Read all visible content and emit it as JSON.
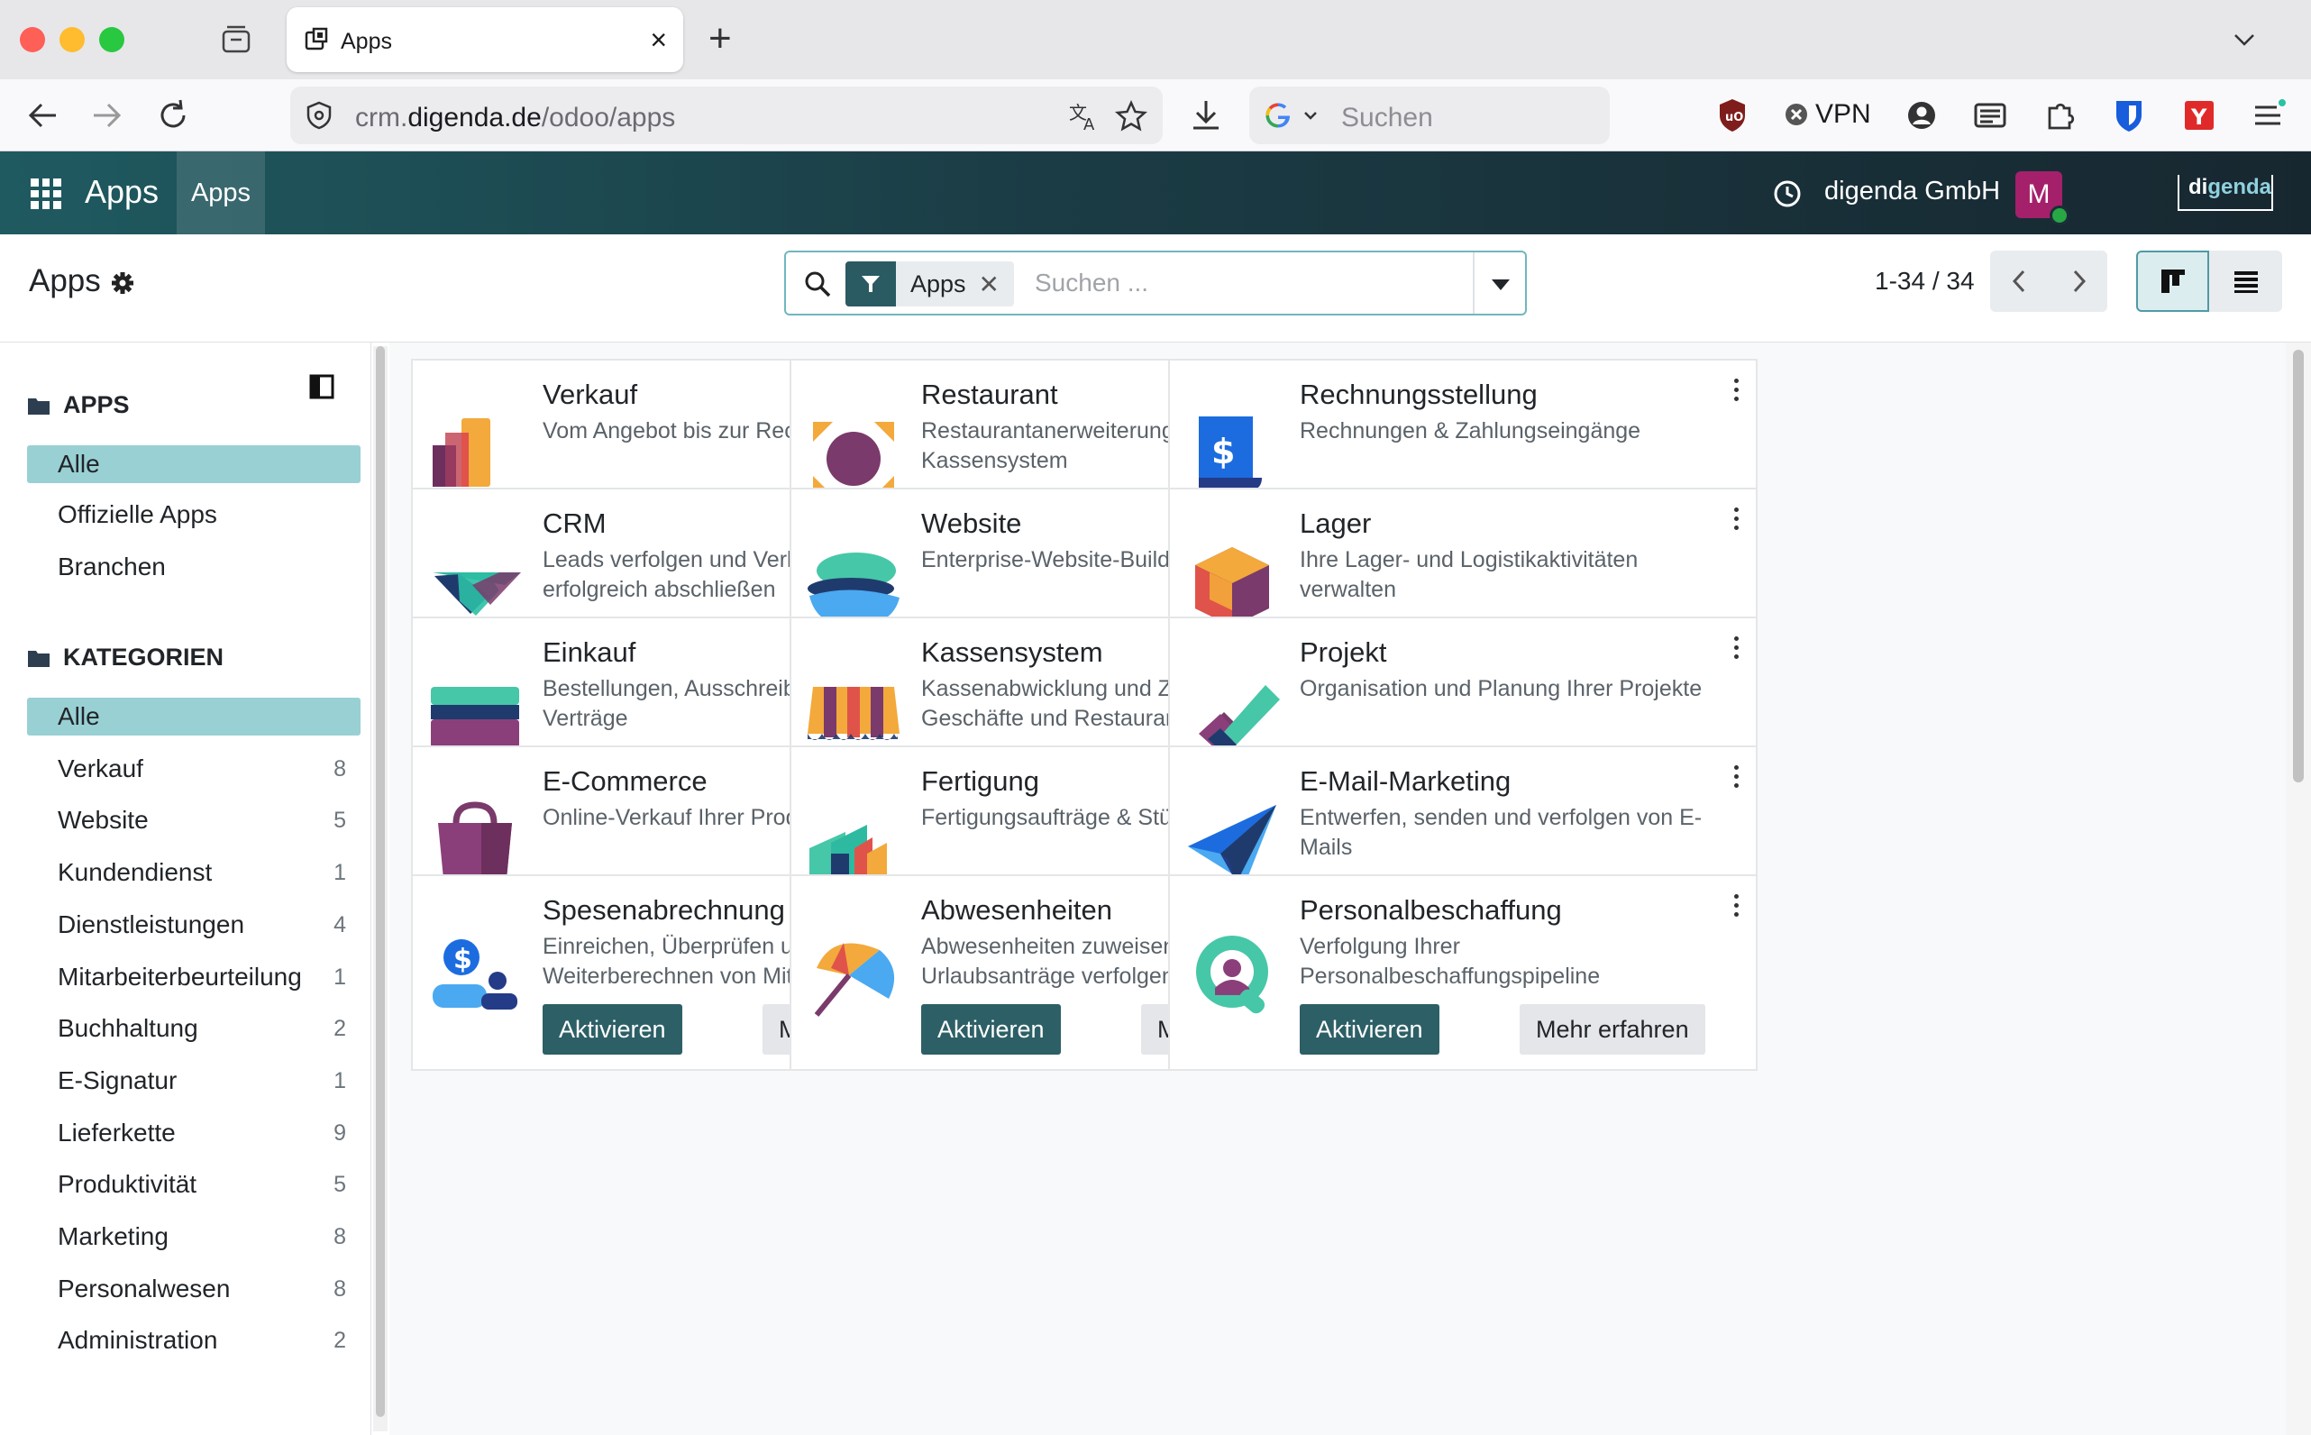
{
  "browser": {
    "tab_title": "Apps",
    "url_host": "crm.",
    "url_domain": "digenda.de",
    "url_path": "/odoo/apps",
    "search_placeholder": "Suchen",
    "vpn_label": "VPN"
  },
  "topbar": {
    "brand": "Apps",
    "menu_item": "Apps",
    "company": "digenda GmbH",
    "avatar_letter": "M",
    "logo_text_a": "di",
    "logo_text_b": "genda"
  },
  "control_panel": {
    "title": "Apps",
    "facet_label": "Apps",
    "search_placeholder": "Suchen ...",
    "pager": "1-34 / 34"
  },
  "sidebar": {
    "apps_header": "APPS",
    "apps_items": [
      {
        "label": "Alle"
      },
      {
        "label": "Offizielle Apps"
      },
      {
        "label": "Branchen"
      }
    ],
    "categories_header": "KATEGORIEN",
    "category_items": [
      {
        "label": "Alle",
        "count": ""
      },
      {
        "label": "Verkauf",
        "count": "8"
      },
      {
        "label": "Website",
        "count": "5"
      },
      {
        "label": "Kundendienst",
        "count": "1"
      },
      {
        "label": "Dienstleistungen",
        "count": "4"
      },
      {
        "label": "Mitarbeiterbeurteilung",
        "count": "1"
      },
      {
        "label": "Buchhaltung",
        "count": "2"
      },
      {
        "label": "E-Signatur",
        "count": "1"
      },
      {
        "label": "Lieferkette",
        "count": "9"
      },
      {
        "label": "Produktivität",
        "count": "5"
      },
      {
        "label": "Marketing",
        "count": "8"
      },
      {
        "label": "Personalwesen",
        "count": "8"
      },
      {
        "label": "Administration",
        "count": "2"
      }
    ]
  },
  "buttons": {
    "activate": "Aktivieren",
    "learn_more": "Mehr erfahren"
  },
  "apps": [
    {
      "name": "Verkauf",
      "desc": "Vom Angebot bis zur Rechnung",
      "icon": "sales-icon",
      "installed": false
    },
    {
      "name": "Restaurant",
      "desc": "Restaurantanerweiterungen für das Kassensystem",
      "icon": "restaurant-icon",
      "installed": false
    },
    {
      "name": "Rechnungsstellung",
      "desc": "Rechnungen & Zahlungseingänge",
      "icon": "invoicing-icon",
      "installed": true
    },
    {
      "name": "CRM",
      "desc": "Leads verfolgen und Verkaufschancen erfolgreich abschließen",
      "icon": "crm-icon",
      "installed": true
    },
    {
      "name": "Website",
      "desc": "Enterprise-Website-Builder",
      "icon": "website-icon",
      "installed": false
    },
    {
      "name": "Lager",
      "desc": "Ihre Lager- und Logistikaktivitäten verwalten",
      "icon": "inventory-icon",
      "installed": false
    },
    {
      "name": "Einkauf",
      "desc": "Bestellungen, Ausschreibungen und Verträge",
      "icon": "purchase-icon",
      "installed": false
    },
    {
      "name": "Kassensystem",
      "desc": "Kassenabwicklung und Zahlungen für Geschäfte und Restaurants verwalten",
      "icon": "pos-icon",
      "installed": false
    },
    {
      "name": "Projekt",
      "desc": "Organisation und Planung Ihrer Projekte",
      "icon": "project-icon",
      "installed": false
    },
    {
      "name": "E-Commerce",
      "desc": "Online-Verkauf Ihrer Produkte",
      "icon": "ecommerce-icon",
      "installed": false
    },
    {
      "name": "Fertigung",
      "desc": "Fertigungsaufträge & Stücklisten",
      "icon": "manufacturing-icon",
      "installed": false
    },
    {
      "name": "E-Mail-Marketing",
      "desc": "Entwerfen, senden und verfolgen von E-Mails",
      "icon": "email-marketing-icon",
      "installed": false
    },
    {
      "name": "Spesenabrechnung",
      "desc": "Einreichen, Überprüfen und Weiterberechnen von Mitarbeiterspesen",
      "icon": "expenses-icon",
      "installed": false
    },
    {
      "name": "Abwesenheiten",
      "desc": "Abwesenheiten zuweisen und Urlaubsanträge verfolgen",
      "icon": "time-off-icon",
      "installed": false
    },
    {
      "name": "Personalbeschaffung",
      "desc": "Verfolgung Ihrer Personalbeschaffungspipeline",
      "icon": "recruitment-icon",
      "installed": false
    }
  ]
}
